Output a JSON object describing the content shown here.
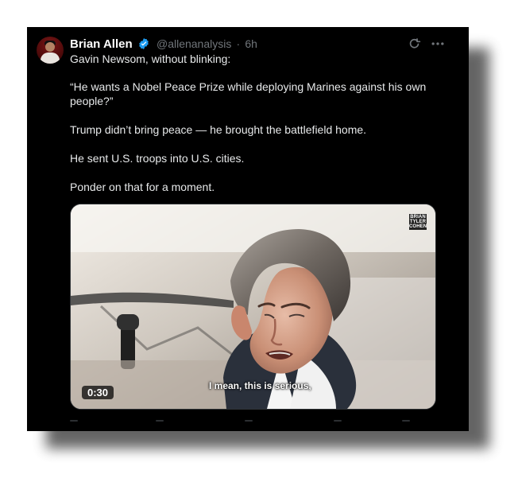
{
  "tweet": {
    "author_name": "Brian Allen",
    "handle": "@allenanalysis",
    "separator": "·",
    "time": "6h",
    "paragraphs": [
      "Gavin Newsom, without blinking:",
      "“He wants a Nobel Peace Prize while deploying Marines against his own people?”",
      "Trump didn’t bring peace — he brought the battlefield home.",
      "He sent U.S. troops into U.S. cities.",
      "Ponder on that for a moment."
    ]
  },
  "media": {
    "duration": "0:30",
    "caption": "I mean, this is serious,",
    "logo_lines": [
      "BRIAN",
      "TYLER",
      "COHEN"
    ]
  },
  "icons": {
    "avatar": "avatar",
    "verified": "verified-badge-icon",
    "refresh": "refresh-icon",
    "more": "more-icon"
  },
  "colors": {
    "background": "#000000",
    "text": "#e7e9ea",
    "muted": "#71767b",
    "verified": "#1d9bf0"
  }
}
